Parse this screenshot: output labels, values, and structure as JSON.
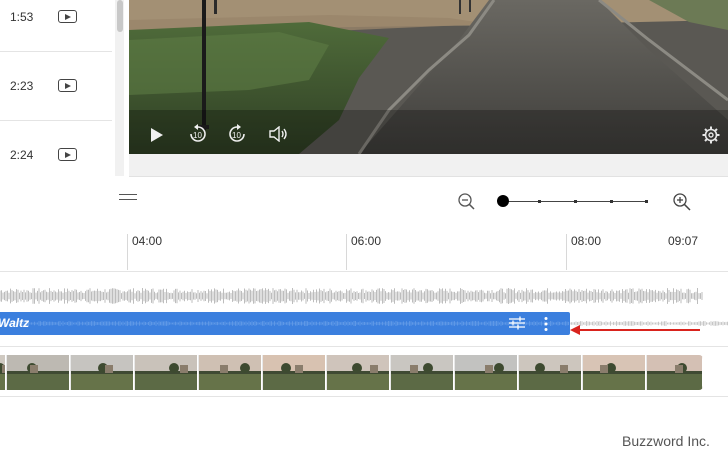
{
  "media_list": {
    "items": [
      {
        "duration": "1:53",
        "icon": "youtube-icon"
      },
      {
        "duration": "2:23",
        "icon": "youtube-icon"
      },
      {
        "duration": "2:24",
        "icon": "youtube-icon"
      }
    ]
  },
  "player": {
    "controls": {
      "play": "play-icon",
      "rewind": "replay-10-icon",
      "forward": "forward-10-icon",
      "volume": "volume-icon",
      "settings": "gear-icon"
    },
    "replay_label": "10",
    "forward_label": "10"
  },
  "timeline": {
    "zoom": {
      "level_index": 0,
      "steps": 5
    },
    "ruler_labels": [
      "04:00",
      "06:00",
      "08:00",
      "09:07"
    ],
    "audio_clip": {
      "title": "Waltz",
      "color": "#3b7fde"
    },
    "trim_arrow_color": "#d9231d"
  },
  "watermark": "Buzzword Inc."
}
